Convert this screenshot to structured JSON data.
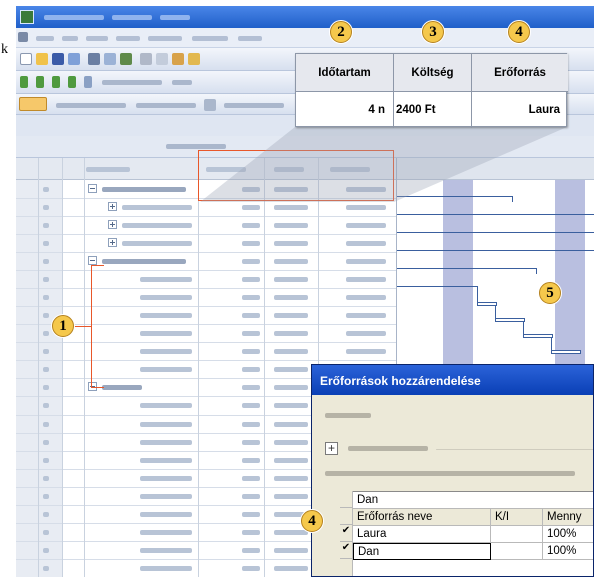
{
  "left_edge_letter": "k",
  "callout": {
    "columns": [
      {
        "header": "Időtartam",
        "value": "4 n",
        "badge": "2"
      },
      {
        "header": "Költség",
        "value": "2400 Ft",
        "badge": "3"
      },
      {
        "header": "Erőforrás",
        "value": "Laura",
        "badge": "4"
      }
    ]
  },
  "badges": {
    "summary_bracket": "1",
    "gantt": "5",
    "dialog_resource": "4"
  },
  "dialog": {
    "title": "Erőforrások hozzárendelése",
    "selected_resource": "Dan",
    "columns": [
      "Erőforrás neve",
      "K/I",
      "Menny"
    ],
    "rows": [
      {
        "check": "✔",
        "name": "Laura",
        "ki": "",
        "amount": "100%"
      },
      {
        "check": "✔",
        "name": "Dan",
        "ki": "",
        "amount": "100%"
      }
    ]
  },
  "colors": {
    "highlight": "#e8572a",
    "badge_fill": "#f5c84c",
    "titlebar": "#1f5fc9",
    "weekend_shading": "#b9bfe0"
  }
}
